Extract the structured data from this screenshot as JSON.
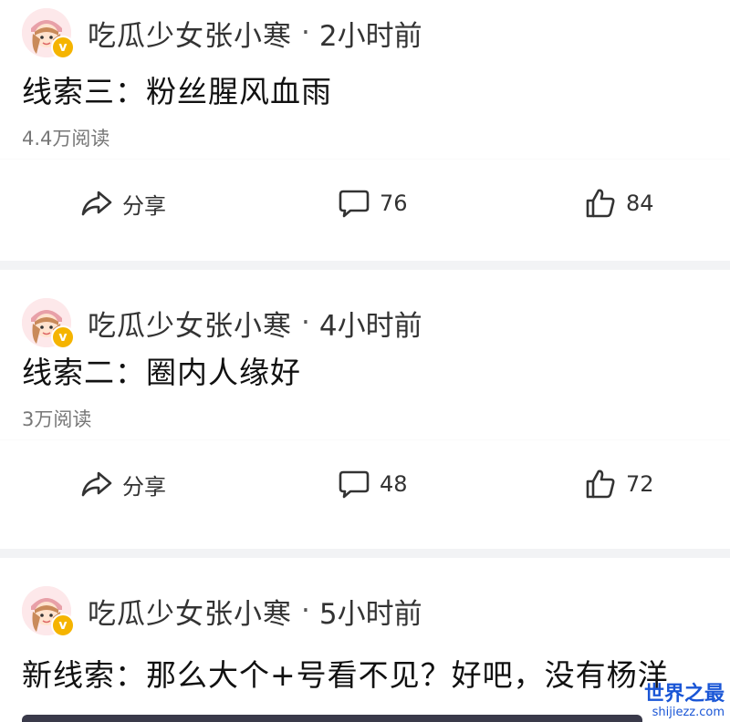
{
  "posts": [
    {
      "author": "吃瓜少女张小寒",
      "separator": "·",
      "time": "2小时前",
      "title": "线索三：粉丝腥风血雨",
      "reads": "4.4万阅读",
      "share_label": "分享",
      "comments": "76",
      "likes": "84"
    },
    {
      "author": "吃瓜少女张小寒",
      "separator": "·",
      "time": "4小时前",
      "title": "线索二：圈内人缘好",
      "reads": "3万阅读",
      "share_label": "分享",
      "comments": "48",
      "likes": "72"
    },
    {
      "author": "吃瓜少女张小寒",
      "separator": "·",
      "time": "5小时前",
      "title": "新线索：那么大个+号看不见？好吧，没有杨洋"
    }
  ],
  "badge": {
    "symbol": "v",
    "color": "#f5b400"
  },
  "watermark": {
    "main": "世界之最",
    "sub": "shijiezz.com"
  },
  "colors": {
    "background": "#f2f3f5",
    "card": "#ffffff",
    "watermark": "#1a56d6"
  }
}
